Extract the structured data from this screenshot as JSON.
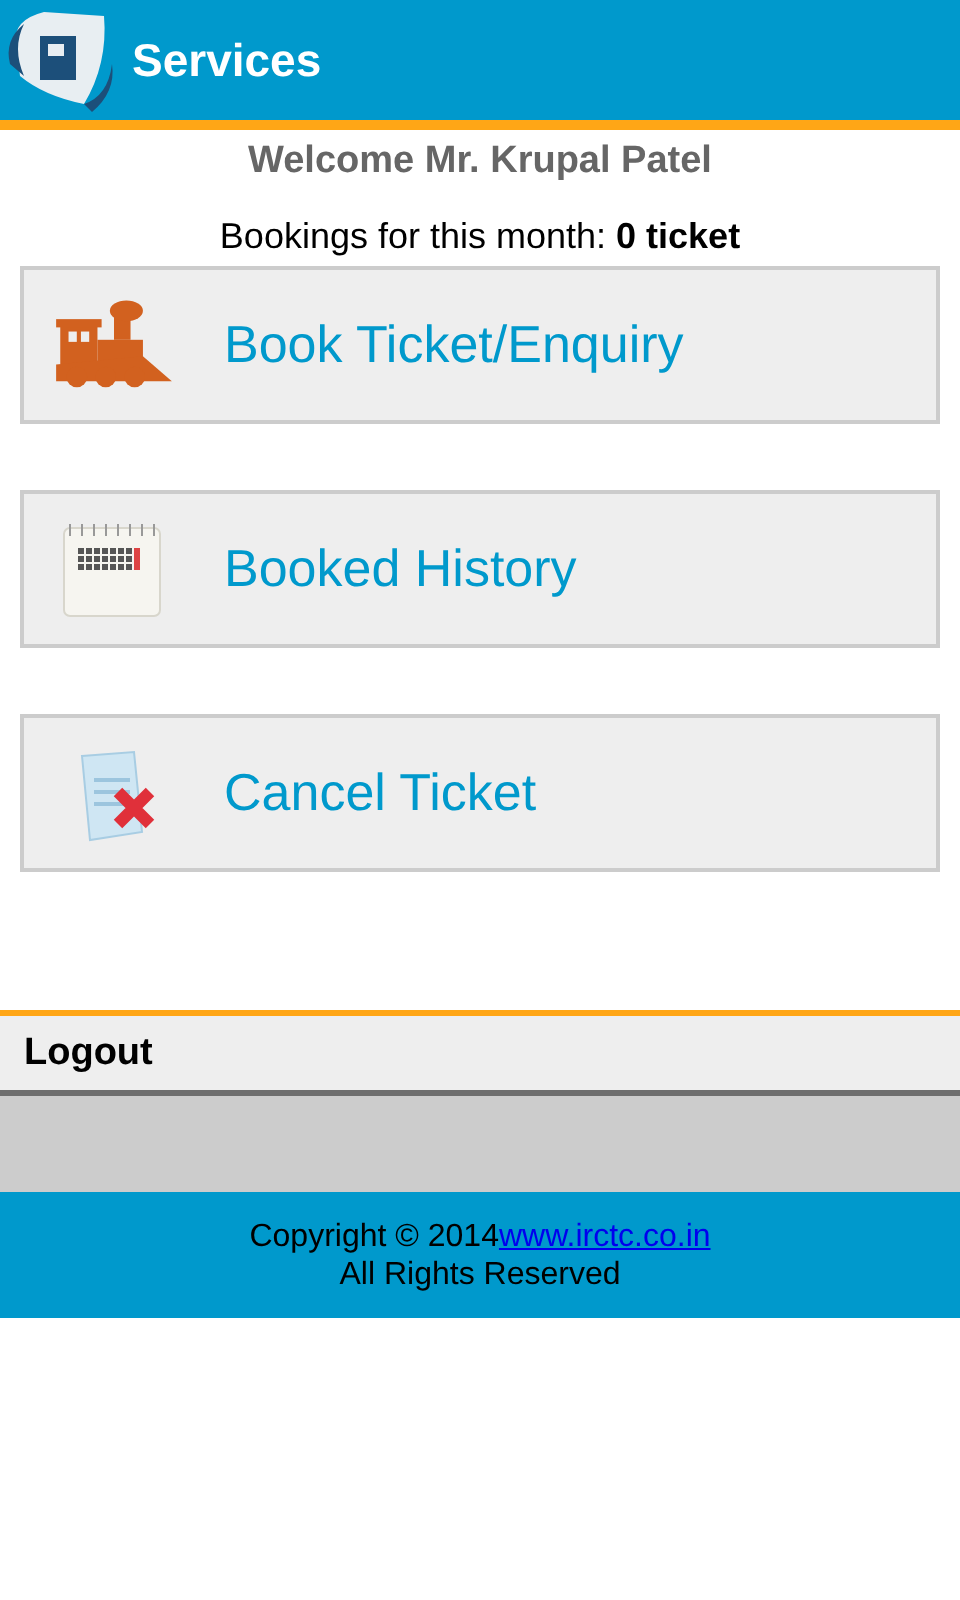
{
  "header": {
    "title": "Services"
  },
  "welcome": "Welcome Mr. Krupal Patel",
  "bookings": "Bookings for this month: **0 ticket**",
  "menu": [
    {
      "kind": "train",
      "label": "Book Ticket/Enquiry"
    },
    {
      "kind": "calendar",
      "label": "Booked History"
    },
    {
      "kind": "cancel",
      "label": "Cancel Ticket"
    }
  ],
  "logout": "Logout",
  "footer": {
    "copyright": "Copyright © 2014",
    "link": "www.irctc.co.in",
    "rights": "All Rights Reserved"
  }
}
